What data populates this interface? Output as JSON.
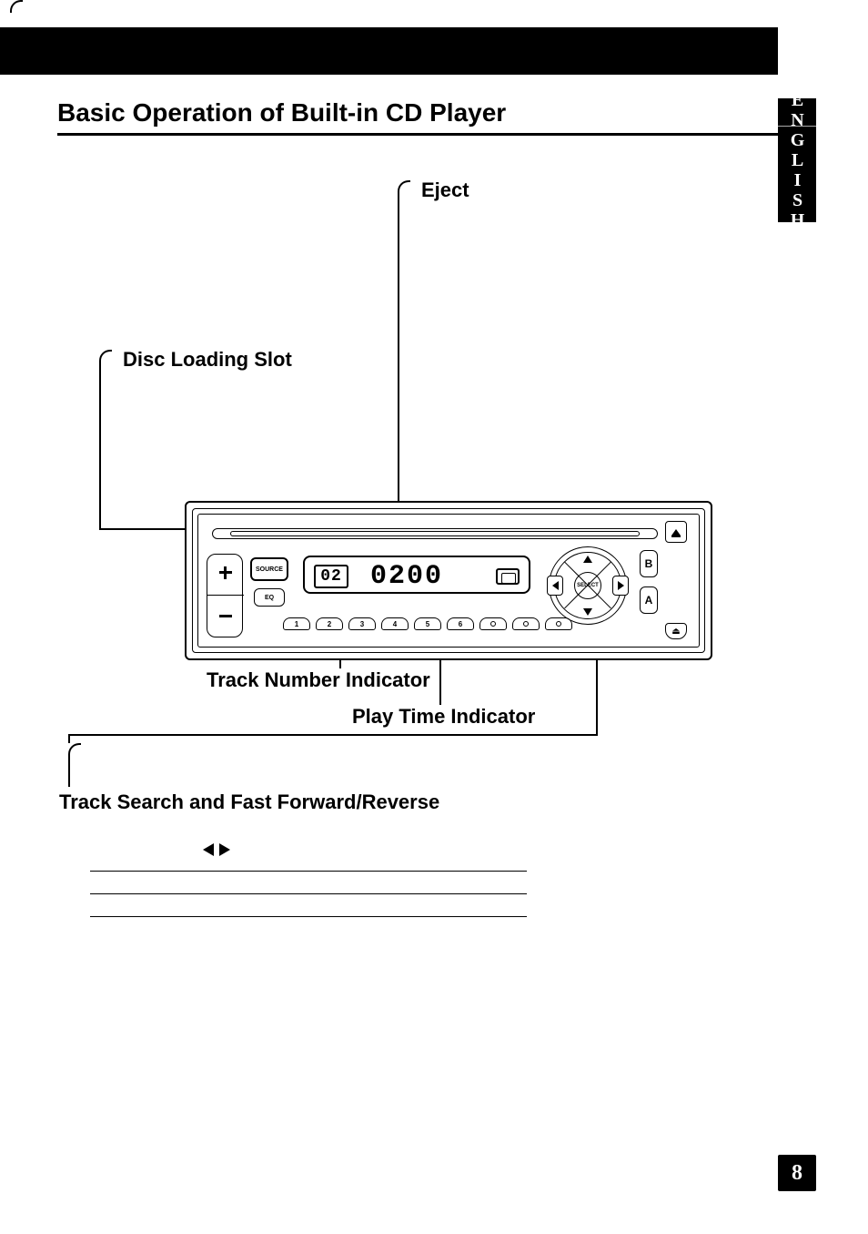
{
  "page_number": "8",
  "language_tab": "ENGLISH",
  "heading": "Basic Operation of Built-in CD Player",
  "labels": {
    "eject": "Eject",
    "disc_slot": "Disc Loading Slot",
    "track_number": "Track Number Indicator",
    "play_time": "Play Time Indicator",
    "track_search": "Track Search and Fast Forward/Reverse"
  },
  "device": {
    "buttons": {
      "source": "SOURCE",
      "eq": "EQ",
      "select": "SELECT",
      "b": "B",
      "a": "A"
    },
    "display": {
      "track": "02",
      "time": "0200"
    },
    "presets": [
      "1",
      "2",
      "3",
      "4",
      "5",
      "6"
    ]
  }
}
